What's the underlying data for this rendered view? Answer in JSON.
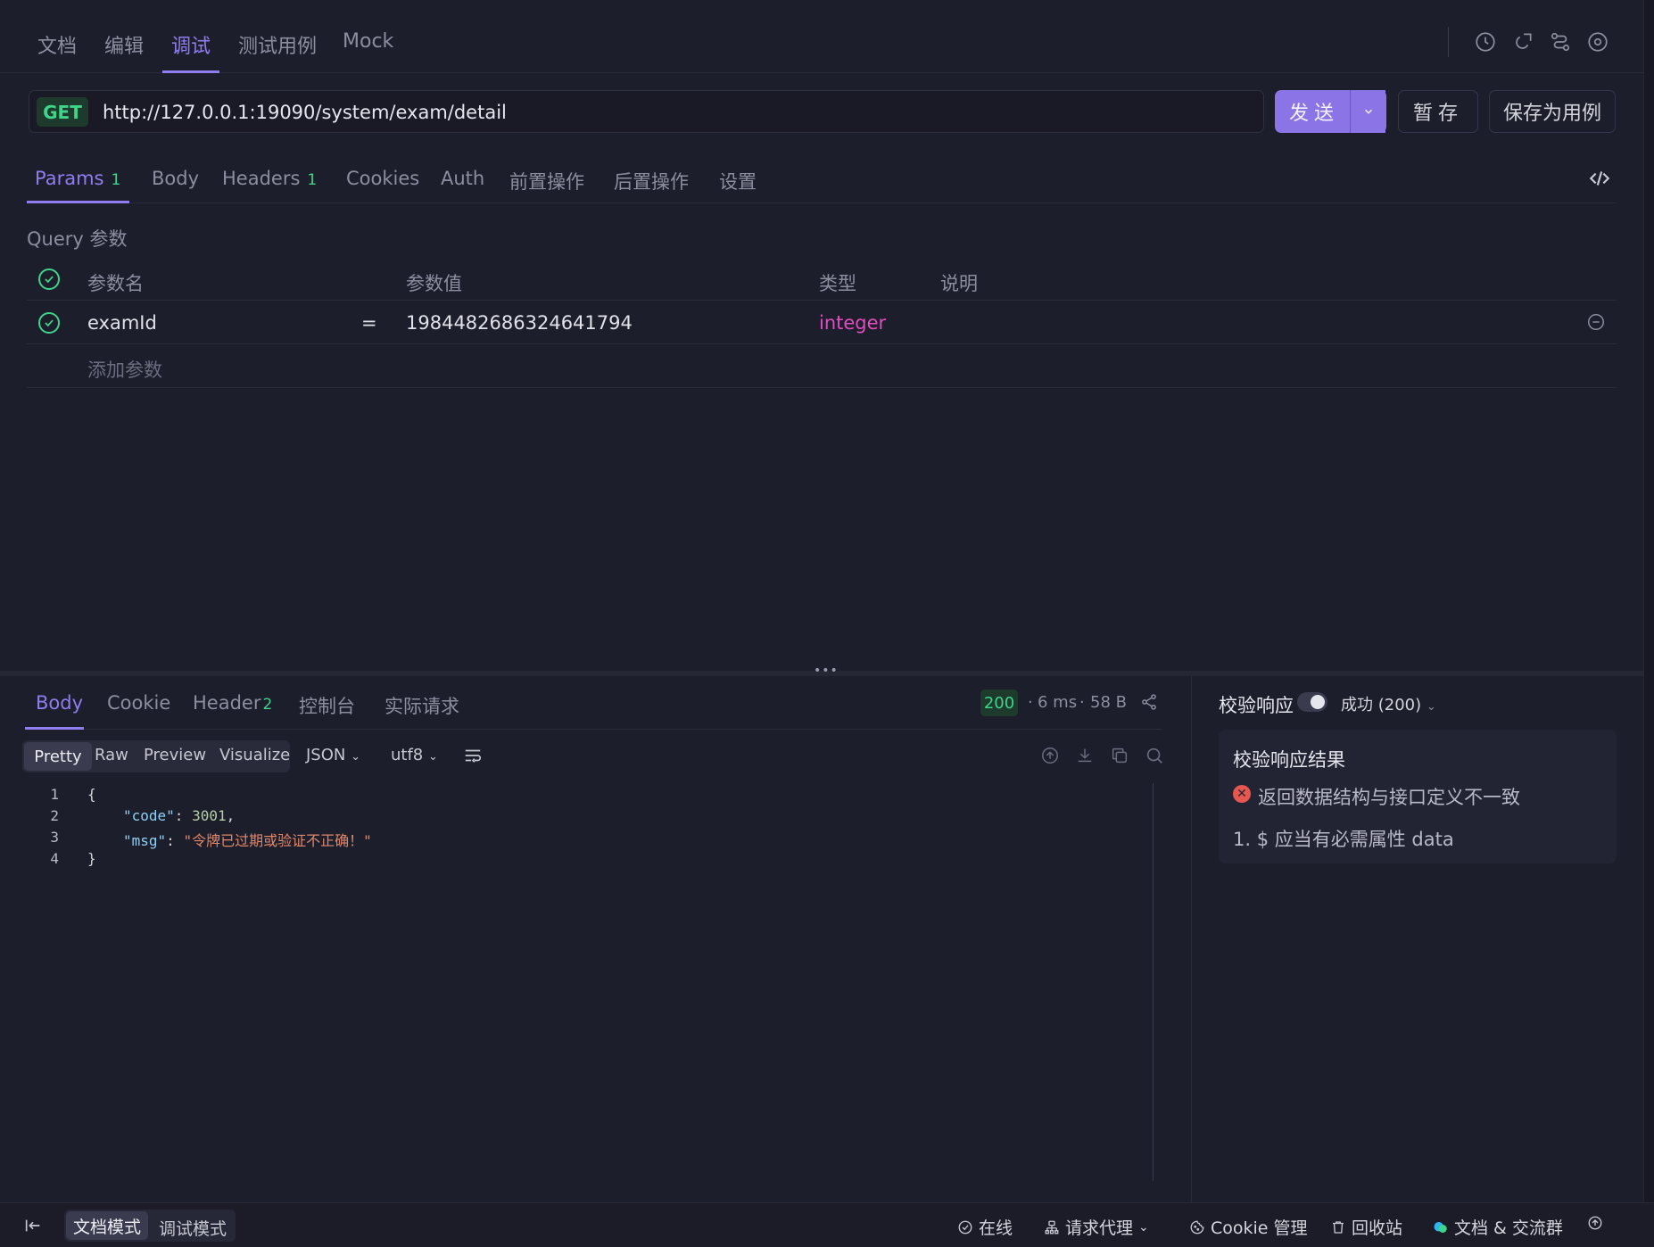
{
  "top_tabs": [
    {
      "label": "文档"
    },
    {
      "label": "编辑"
    },
    {
      "label": "调试"
    },
    {
      "label": "测试用例"
    },
    {
      "label": "Mock"
    }
  ],
  "request": {
    "method": "GET",
    "url": "http://127.0.0.1:19090/system/exam/detail",
    "send_label": "发送",
    "save_temp_label": "暂存",
    "save_case_label": "保存为用例"
  },
  "request_tabs": [
    {
      "label": "Params",
      "count": "1"
    },
    {
      "label": "Body"
    },
    {
      "label": "Headers",
      "count": "1"
    },
    {
      "label": "Cookies"
    },
    {
      "label": "Auth"
    },
    {
      "label": "前置操作"
    },
    {
      "label": "后置操作"
    },
    {
      "label": "设置"
    }
  ],
  "query": {
    "section_label": "Query 参数",
    "columns": [
      "参数名",
      "参数值",
      "类型",
      "说明"
    ],
    "params": [
      {
        "name": "examId",
        "op": "=",
        "value": "1984482686324641794",
        "type": "integer",
        "desc": ""
      }
    ],
    "add_placeholder": "添加参数"
  },
  "response": {
    "tabs": [
      {
        "label": "Body"
      },
      {
        "label": "Cookie"
      },
      {
        "label": "Header",
        "count": "2"
      },
      {
        "label": "控制台"
      },
      {
        "label": "实际请求"
      }
    ],
    "status": "200",
    "time": "6 ms",
    "size": "58 B",
    "view_modes": [
      "Pretty",
      "Raw",
      "Preview",
      "Visualize"
    ],
    "format": "JSON",
    "encoding": "utf8",
    "code_lines": [
      "1",
      "2",
      "3",
      "4"
    ],
    "json": {
      "code_key": "\"code\"",
      "code_value": "3001",
      "msg_key": "\"msg\"",
      "msg_value": "\"令牌已过期或验证不正确！\""
    }
  },
  "validation": {
    "label": "校验响应",
    "enabled": true,
    "selected": "成功 (200)",
    "result_title": "校验响应结果",
    "error": "返回数据结构与接口定义不一致",
    "detail": "1. $ 应当有必需属性 data"
  },
  "status_bar": {
    "modes": [
      "文档模式",
      "调试模式"
    ],
    "online": "在线",
    "proxy": "请求代理",
    "cookie": "Cookie 管理",
    "trash": "回收站",
    "docs": "文档 & 交流群"
  },
  "colors": {
    "accent": "#8f7df0",
    "success": "#3ed48a",
    "type": "#e04dbf",
    "error": "#e5574f"
  }
}
